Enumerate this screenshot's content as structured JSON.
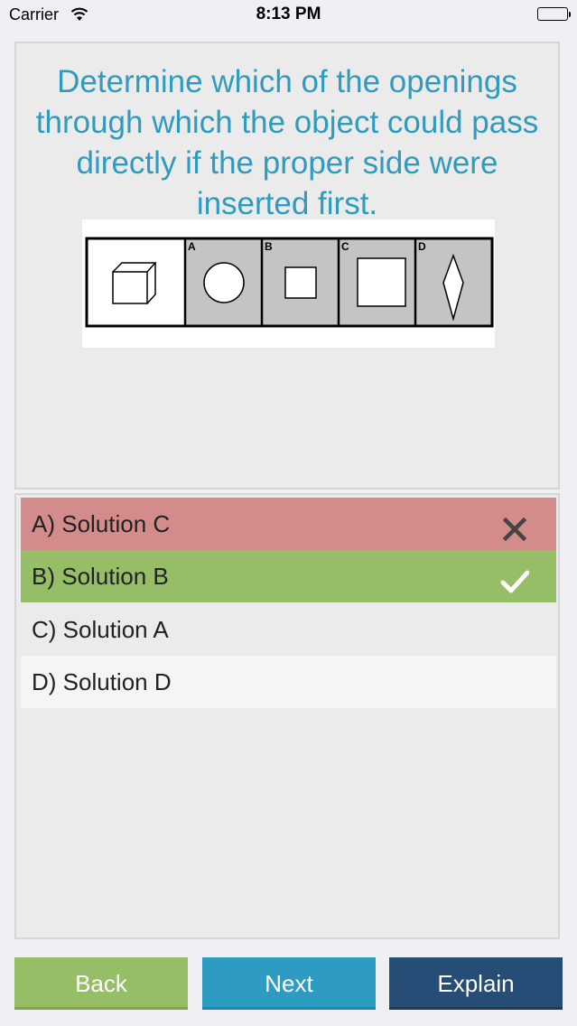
{
  "status_bar": {
    "carrier": "Carrier",
    "time": "8:13 PM"
  },
  "question": {
    "text": "Determine which of the openings through which the object could pass directly if the proper side were inserted first.",
    "figure": {
      "option_labels": [
        "A",
        "B",
        "C",
        "D"
      ]
    }
  },
  "answers": [
    {
      "label": "A) Solution C",
      "state": "incorrect",
      "icon": "close-icon"
    },
    {
      "label": "B) Solution B",
      "state": "correct",
      "icon": "check-icon"
    },
    {
      "label": "C) Solution A",
      "state": "neutral"
    },
    {
      "label": "D) Solution D",
      "state": "neutral"
    }
  ],
  "buttons": {
    "back": "Back",
    "next": "Next",
    "explain": "Explain"
  },
  "colors": {
    "question_text": "#2f9bbf",
    "incorrect": "#d38b8b",
    "correct": "#96be67",
    "next": "#2e9cc2",
    "explain": "#264d75"
  }
}
